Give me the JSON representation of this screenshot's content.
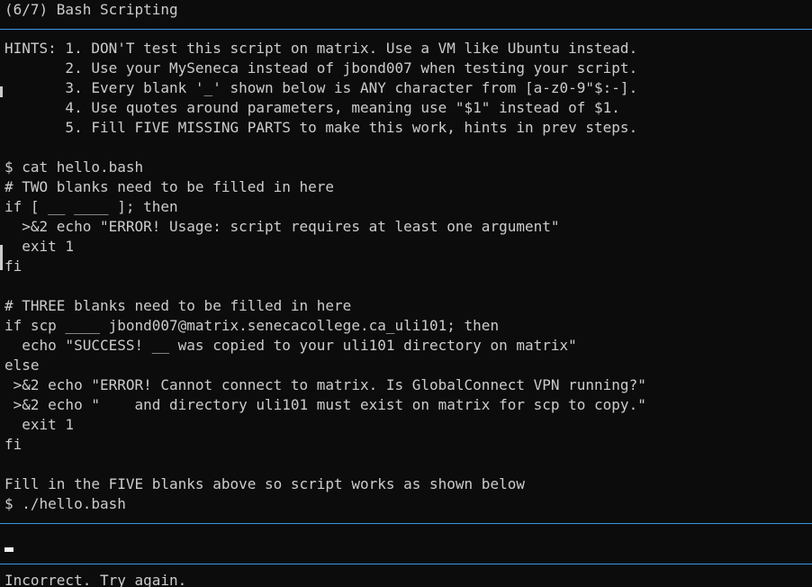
{
  "title": "(6/7) Bash Scripting",
  "hints": [
    "HINTS: 1. DON'T test this script on matrix. Use a VM like Ubuntu instead.",
    "       2. Use your MySeneca instead of jbond007 when testing your script.",
    "       3. Every blank '_' shown below is ANY character from [a-z0-9\"$:-].",
    "       4. Use quotes around parameters, meaning use \"$1\" instead of $1.",
    "       5. Fill FIVE MISSING PARTS to make this work, hints in prev steps."
  ],
  "script": [
    "$ cat hello.bash",
    "# TWO blanks need to be filled in here",
    "if [ __ ____ ]; then",
    "  >&2 echo \"ERROR! Usage: script requires at least one argument\"",
    "  exit 1",
    "fi",
    "",
    "# THREE blanks need to be filled in here",
    "if scp ____ jbond007@matrix.senecacollege.ca_uli101; then",
    "  echo \"SUCCESS! __ was copied to your uli101 directory on matrix\"",
    "else",
    " >&2 echo \"ERROR! Cannot connect to matrix. Is GlobalConnect VPN running?\"",
    " >&2 echo \"    and directory uli101 must exist on matrix for scp to copy.\"",
    "  exit 1",
    "fi",
    "",
    "Fill in the FIVE blanks above so script works as shown below",
    "$ ./hello.bash"
  ],
  "feedback": "Incorrect. Try again.",
  "colors": {
    "background": "#0c0c0c",
    "text": "#cccccc",
    "rule": "#3a96dd",
    "cursor": "#f2f2f2"
  }
}
